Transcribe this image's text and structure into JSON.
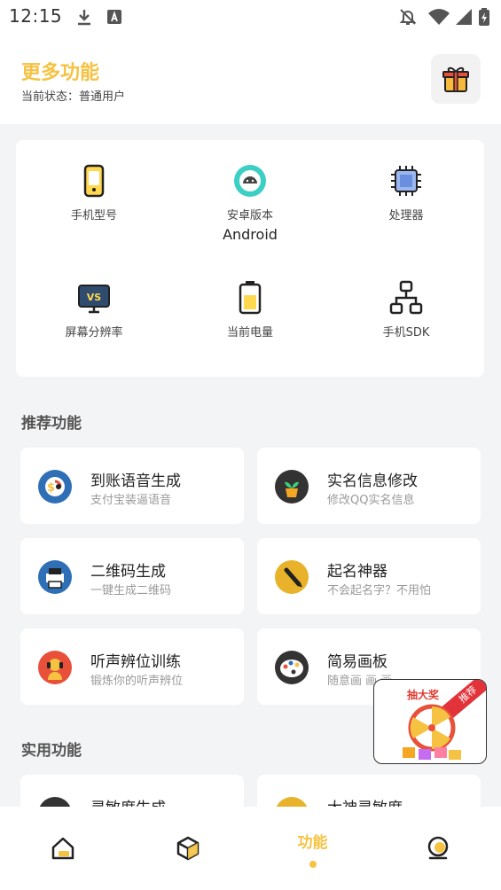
{
  "status_bar": {
    "time": "12:15"
  },
  "header": {
    "title": "更多功能",
    "subtitle": "当前状态：普通用户"
  },
  "device_info": {
    "items": [
      {
        "label": "手机型号",
        "value": ""
      },
      {
        "label": "安卓版本",
        "value": "Android"
      },
      {
        "label": "处理器",
        "value": ""
      },
      {
        "label": "屏幕分辨率",
        "value": ""
      },
      {
        "label": "当前电量",
        "value": ""
      },
      {
        "label": "手机SDK",
        "value": ""
      }
    ]
  },
  "recommended": {
    "title": "推荐功能",
    "items": [
      {
        "name": "到账语音生成",
        "desc": "支付宝装逼语音"
      },
      {
        "name": "实名信息修改",
        "desc": "修改QQ实名信息"
      },
      {
        "name": "二维码生成",
        "desc": "一键生成二维码"
      },
      {
        "name": "起名神器",
        "desc": "不会起名字？不用怕"
      },
      {
        "name": "听声辨位训练",
        "desc": "锻炼你的听声辨位"
      },
      {
        "name": "简易画板",
        "desc": "随意画 画 画…"
      }
    ]
  },
  "practical": {
    "title": "实用功能",
    "items": [
      {
        "name": "灵敏度生成"
      },
      {
        "name": "大神灵敏度"
      }
    ]
  },
  "promo": {
    "title": "抽大奖",
    "badge": "推荐"
  },
  "bottom_nav": {
    "active_label": "功能"
  },
  "colors": {
    "accent": "#f5c242",
    "background": "#f3f4f6",
    "card": "#ffffff"
  }
}
